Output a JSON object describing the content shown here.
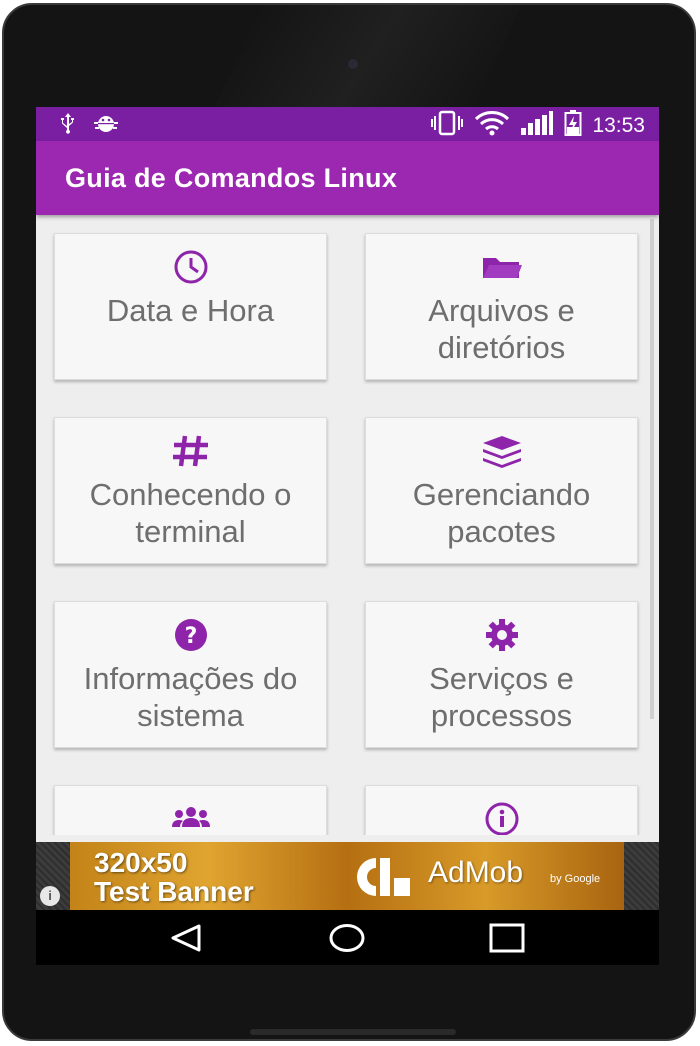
{
  "status_bar": {
    "time": "13:53",
    "icons": [
      "usb-icon",
      "android-debug-icon",
      "vibrate-icon",
      "wifi-icon",
      "signal-icon",
      "battery-charging-icon"
    ]
  },
  "app_bar": {
    "title": "Guia de Comandos Linux"
  },
  "menu": {
    "items": [
      {
        "label": "Data e Hora",
        "icon": "clock-icon"
      },
      {
        "label": "Arquivos e diretórios",
        "icon": "folder-icon"
      },
      {
        "label": "Conhecendo o terminal",
        "icon": "hashtag-icon"
      },
      {
        "label": "Gerenciando pacotes",
        "icon": "layers-icon"
      },
      {
        "label": "Informações do sistema",
        "icon": "question-icon"
      },
      {
        "label": "Serviços e processos",
        "icon": "gear-icon"
      },
      {
        "label": "",
        "icon": "users-icon"
      },
      {
        "label": "",
        "icon": "info-icon"
      }
    ]
  },
  "ad_banner": {
    "line1": "320x50",
    "line2": "Test Banner",
    "brand": "AdMob",
    "by": "by Google",
    "info": "i"
  },
  "nav_bar": {
    "buttons": [
      "back-icon",
      "home-icon",
      "recents-icon"
    ]
  },
  "colors": {
    "status_bar": "#7b1fa2",
    "app_bar": "#9c27b0",
    "accent_icon": "#8e24aa",
    "card_text": "#6e6e6e"
  }
}
